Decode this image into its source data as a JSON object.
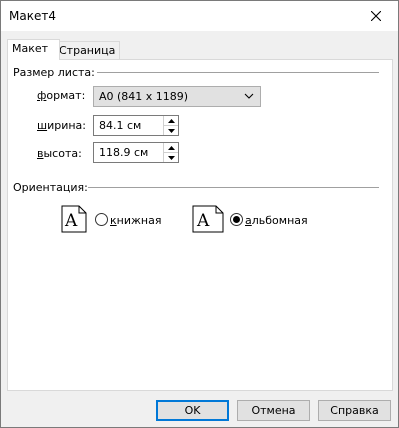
{
  "window": {
    "title": "Макет4"
  },
  "tabs": [
    {
      "label": "Макет",
      "active": true
    },
    {
      "label": "Страница",
      "active": false
    }
  ],
  "sheet_size": {
    "group_label": "Размер листа:",
    "format": {
      "label_prefix": "ф",
      "label_rest": "ормат:",
      "value": "A0 (841 x 1189)"
    },
    "width": {
      "label_prefix": "ш",
      "label_rest": "ирина:",
      "value": "84.1 см"
    },
    "height": {
      "label_prefix": "в",
      "label_rest": "ысота:",
      "value": "118.9 см"
    }
  },
  "orientation": {
    "group_label": "Ориентация:",
    "portrait": {
      "label_prefix": "к",
      "label_rest": "нижная",
      "checked": false,
      "icon_letter": "A"
    },
    "landscape": {
      "label_prefix": "а",
      "label_rest": "льбомная",
      "checked": true,
      "icon_letter": "A"
    }
  },
  "buttons": {
    "ok": "OK",
    "cancel": "Отмена",
    "help": "Справка"
  }
}
